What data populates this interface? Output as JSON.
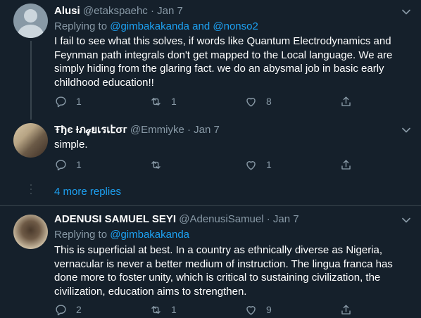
{
  "tweets": [
    {
      "name": "Alusi",
      "handle": "@etakspaehc",
      "dot": "·",
      "date": "Jan 7",
      "replying_prefix": "Replying to ",
      "replying_mention_1": "@gimbakakanda",
      "replying_and": " and ",
      "replying_mention_2": "@nonso2",
      "text": "I fail to see what this solves, if words like Quantum Electrodynamics and\nFeynman path integrals don't get mapped to the Local language. We are\nsimply hiding from the glaring fact. we do an abysmal job in basic early\nchildhood education!!",
      "reply_count": "1",
      "retweet_count": "1",
      "like_count": "8"
    },
    {
      "name": "Ŧђє Ɨภ𝓆ยเรเէσг",
      "handle": "@Emmiyke",
      "dot": "·",
      "date": "Jan 7",
      "text": "simple.",
      "reply_count": "1",
      "retweet_count": "",
      "like_count": "1"
    },
    {
      "name": "ADENUSI SAMUEL SEYI",
      "handle": "@AdenusiSamuel",
      "dot": "·",
      "date": "Jan 7",
      "replying_prefix": "Replying to ",
      "replying_mention_1": "@gimbakakanda",
      "text": "This is superficial at best. In a country as ethnically diverse as Nigeria,\nvernacular is never a better medium of instruction. The lingua franca has\ndone more to foster unity, which is critical to sustaining civilization, the\ncivilization, education aims to strengthen.",
      "reply_count": "2",
      "retweet_count": "1",
      "like_count": "9"
    }
  ],
  "more_replies": "4 more replies",
  "icons": {
    "reply": "reply-icon",
    "retweet": "retweet-icon",
    "like": "heart-icon",
    "share": "share-icon",
    "more": "chevron-down-icon"
  },
  "colors": {
    "background": "#15202b",
    "secondary_text": "#8899a6",
    "link": "#1da1f2",
    "border": "#38444d"
  }
}
